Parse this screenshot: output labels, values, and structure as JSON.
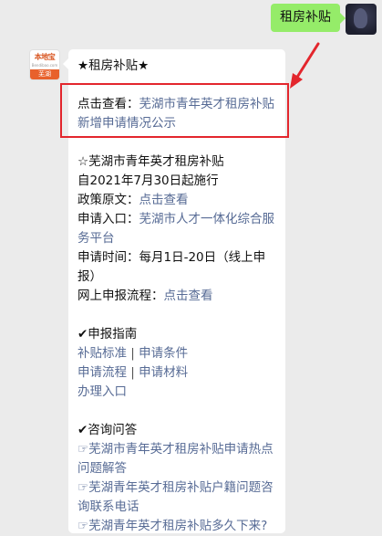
{
  "outgoing": {
    "text": "租房补贴"
  },
  "account": {
    "brand": "本地宝",
    "brand_sub": "Bendibao.com",
    "city": "芜湖"
  },
  "reply": {
    "title": "★租房补贴★",
    "highlight": {
      "label": "点击查看：",
      "link": "芜湖市青年英才租房补贴新增申请情况公示"
    },
    "section1": {
      "heading": "☆芜湖市青年英才租房补贴",
      "effective": "自2021年7月30日起施行",
      "policy_label": "政策原文：",
      "policy_link": "点击查看",
      "entry_label": "申请入口：",
      "entry_link": "芜湖市人才一体化综合服务平台",
      "time": "申请时间：每月1日-20日（线上申报）",
      "flow_label": "网上申报流程：",
      "flow_link": "点击查看"
    },
    "guide": {
      "heading": "✔申报指南",
      "items": [
        "补贴标准",
        "申请条件",
        "申请流程",
        "申请材料",
        "办理入口"
      ],
      "separator": "|"
    },
    "faq": {
      "heading": "✔咨询问答",
      "items": [
        "☞芜湖市青年英才租房补贴申请热点问题解答",
        "☞芜湖青年英才租房补贴户籍问题咨询联系电话",
        "☞芜湖青年英才租房补贴多久下来?"
      ]
    }
  },
  "colors": {
    "link": "#576b95",
    "bubble_out": "#95ec69",
    "highlight_border": "#e3262d",
    "background": "#ebebeb"
  }
}
